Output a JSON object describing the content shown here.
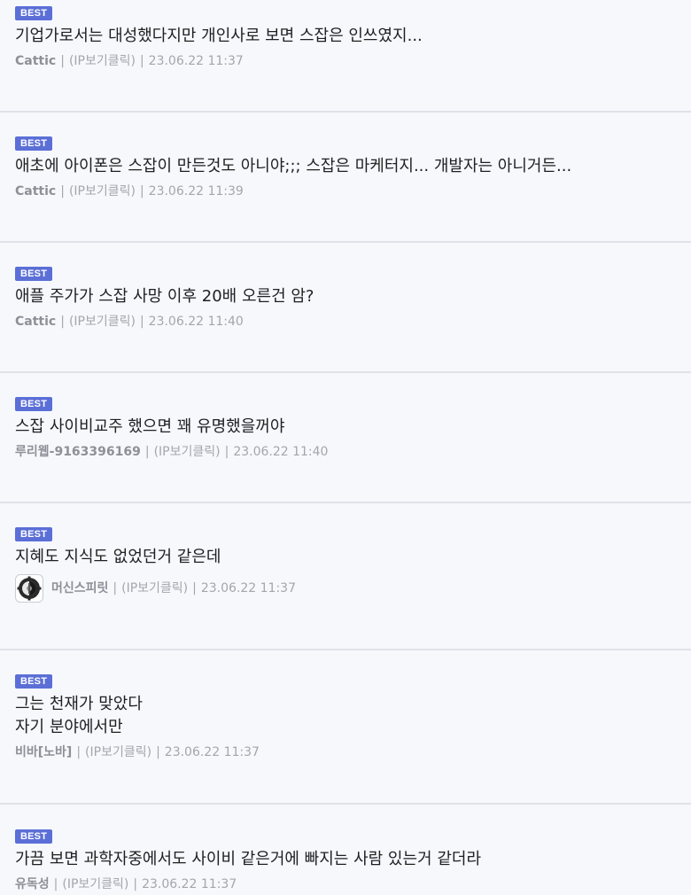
{
  "badge_label": "BEST",
  "comments": [
    {
      "text": "기업가로서는 대성했다지만 개인사로 보면 스잡은 인쓰였지...",
      "author": "Cattic",
      "ip": "(IP보기클릭)",
      "date": "23.06.22 11:37"
    },
    {
      "text": "애초에 아이폰은 스잡이 만든것도 아니야;;; 스잡은 마케터지... 개발자는 아니거든...",
      "author": "Cattic",
      "ip": "(IP보기클릭)",
      "date": "23.06.22 11:39"
    },
    {
      "text": "애플 주가가 스잡 사망 이후 20배 오른건 암?",
      "author": "Cattic",
      "ip": "(IP보기클릭)",
      "date": "23.06.22 11:40"
    },
    {
      "text": "스잡 사이비교주 했으면 꽤 유명했을꺼야",
      "author": "루리웹-9163396169",
      "ip": "(IP보기클릭)",
      "date": "23.06.22 11:40"
    },
    {
      "text": "지혜도 지식도 없었던거 같은데",
      "author": "머신스피릿",
      "ip": "(IP보기클릭)",
      "date": "23.06.22 11:37",
      "avatar_icon": "mechanicus-cog-icon"
    },
    {
      "text": "그는 천재가 맞았다\n자기 분야에서만",
      "author": "비바[노바]",
      "ip": "(IP보기클릭)",
      "date": "23.06.22 11:37"
    },
    {
      "text": "가끔 보면 과학자중에서도 사이비 같은거에 빠지는 사람 있는거 같더라",
      "author": "유독성",
      "ip": "(IP보기클릭)",
      "date": "23.06.22 11:37"
    }
  ],
  "colors": {
    "badge": "#5b6fd6",
    "background": "#f6f8fc",
    "divider": "#dfe2e8",
    "meta_text": "#a3a6ad"
  }
}
